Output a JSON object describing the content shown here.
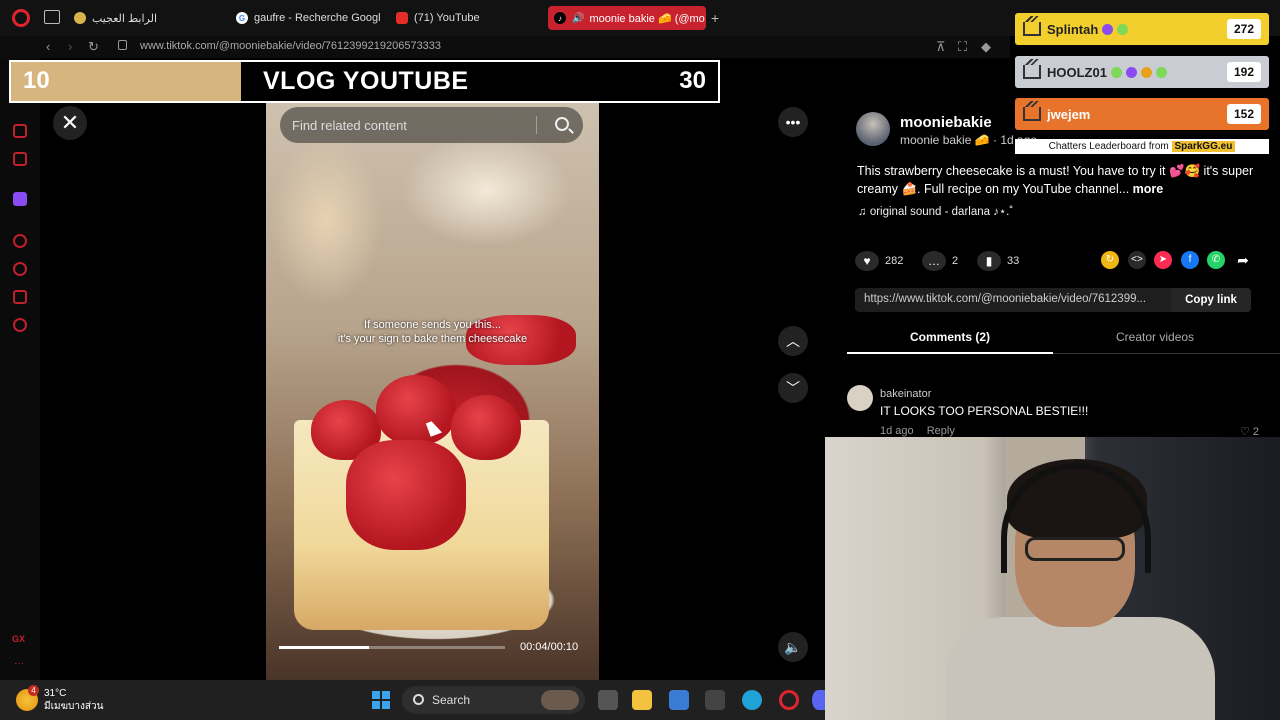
{
  "browser": {
    "tabs": [
      {
        "label": "الرابط العجيب",
        "favicon_color": "#d9b44a"
      },
      {
        "label": "gaufre - Recherche Googl",
        "favicon_color": "#4285f4"
      },
      {
        "label": "(71) YouTube",
        "favicon_color": "#e52d27"
      },
      {
        "label": "moonie bakie 🧀 (@mo",
        "favicon_color": "#000000"
      }
    ],
    "new_tab": "+",
    "url": "www.tiktok.com/@mooniebakie/video/7612399219206573333"
  },
  "overlay": {
    "left_score": "10",
    "title": "VLOG YOUTUBE",
    "right_score": "30",
    "leaderboard": [
      {
        "name": "Splintah",
        "count": "272",
        "bg": "#f2cf2c"
      },
      {
        "name": "HOOLZ01",
        "count": "192",
        "bg": "#c9ccd3"
      },
      {
        "name": "jwejem",
        "count": "152",
        "bg": "#e8732a"
      }
    ],
    "caption_prefix": "Chatters Leaderboard from",
    "caption_brand": "SparkGG.eu"
  },
  "video": {
    "search_placeholder": "Find related content",
    "caption_line1": "If someone sends you this...",
    "caption_line2": "it's your sign to bake them cheesecake",
    "time": "00:04/00:10",
    "progress": 0.4
  },
  "post": {
    "author": "mooniebakie",
    "author_sub": "moonie bakie 🧀 · 1d ago",
    "description": "This strawberry cheesecake is a must! You have to try it 💕🥰 it's super creamy 🍰. Full recipe on my YouTube channel...",
    "more": "more",
    "sound": "original sound - darlana ♪⋆.˚",
    "likes": "282",
    "comments": "2",
    "saves": "33",
    "link": "https://www.tiktok.com/@mooniebakie/video/7612399...",
    "copy_link": "Copy link",
    "tab_comments": "Comments (2)",
    "tab_creator": "Creator videos"
  },
  "comment": {
    "user": "bakeinator",
    "text": "IT LOOKS TOO PERSONAL BESTIE!!!",
    "time": "1d ago",
    "reply": "Reply",
    "likes": "2"
  },
  "taskbar": {
    "temp": "31°C",
    "weather_desc": "มีเมฆบางส่วน",
    "alert": "4",
    "search": "Search"
  },
  "icons": {
    "close": "close-icon",
    "more": "more-icon",
    "up": "chevron-up-icon",
    "down": "chevron-down-icon",
    "volume": "volume-icon"
  }
}
